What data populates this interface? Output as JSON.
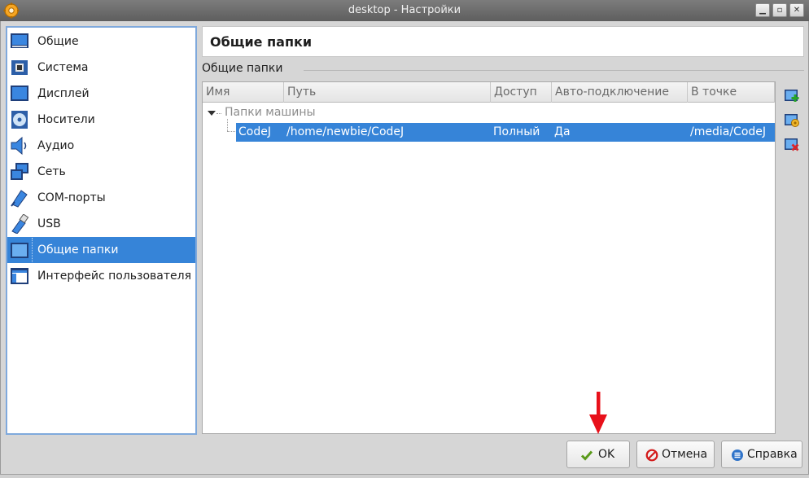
{
  "window": {
    "title": "desktop - Настройки",
    "controls": [
      "minimize-icon",
      "maximize-icon",
      "close-icon"
    ]
  },
  "sidebar": {
    "items": [
      {
        "label": "Общие",
        "icon": "general-icon"
      },
      {
        "label": "Система",
        "icon": "system-icon"
      },
      {
        "label": "Дисплей",
        "icon": "display-icon"
      },
      {
        "label": "Носители",
        "icon": "storage-icon"
      },
      {
        "label": "Аудио",
        "icon": "audio-icon"
      },
      {
        "label": "Сеть",
        "icon": "network-icon"
      },
      {
        "label": "COM-порты",
        "icon": "serial-port-icon"
      },
      {
        "label": "USB",
        "icon": "usb-icon"
      },
      {
        "label": "Общие папки",
        "icon": "shared-folder-icon",
        "selected": true
      },
      {
        "label": "Интерфейс пользователя",
        "icon": "user-interface-icon"
      }
    ]
  },
  "page": {
    "heading": "Общие папки",
    "group_label": "Общие папки"
  },
  "table": {
    "columns": [
      "Имя",
      "Путь",
      "Доступ",
      "Авто-подключение",
      "В точке"
    ],
    "group": "Папки машины",
    "rows": [
      {
        "name": "CodeJ",
        "path": "/home/newbie/CodeJ",
        "access": "Полный",
        "auto_mount": "Да",
        "mount_point": "/media/CodeJ",
        "selected": true
      }
    ]
  },
  "tools": [
    "add-shared-folder-icon",
    "edit-shared-folder-icon",
    "remove-shared-folder-icon"
  ],
  "buttons": {
    "ok": "OK",
    "cancel": "Отмена",
    "help": "Справка"
  },
  "colors": {
    "selection": "#3684d8",
    "annotation_arrow": "#e8101a"
  }
}
